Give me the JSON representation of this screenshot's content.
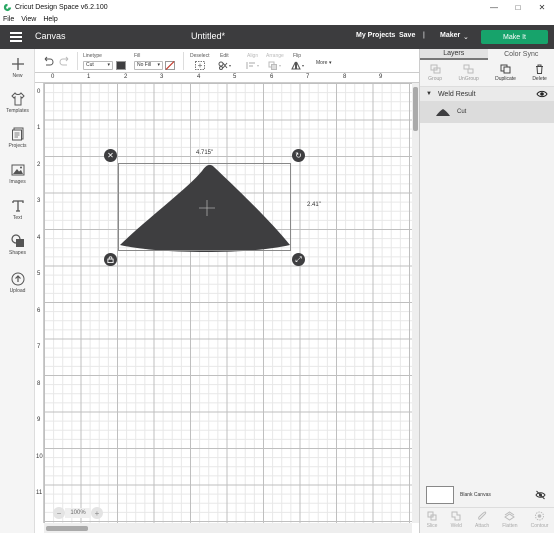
{
  "window": {
    "title": "Cricut Design Space  v6.2.100"
  },
  "menu": [
    "File",
    "View",
    "Help"
  ],
  "header": {
    "section": "Canvas",
    "document_title": "Untitled*",
    "my_projects": "My Projects",
    "save": "Save",
    "separator": "|",
    "machine": "Maker",
    "make_it": "Make It"
  },
  "left_tools": [
    {
      "label": "New",
      "icon": "plus-icon"
    },
    {
      "label": "Templates",
      "icon": "shirt-icon"
    },
    {
      "label": "Projects",
      "icon": "projects-icon"
    },
    {
      "label": "Images",
      "icon": "image-icon"
    },
    {
      "label": "Text",
      "icon": "text-icon"
    },
    {
      "label": "Shapes",
      "icon": "shapes-icon"
    },
    {
      "label": "Upload",
      "icon": "upload-icon"
    }
  ],
  "edit_bar": {
    "linetype_label": "Linetype",
    "linetype_value": "Cut",
    "fill_label": "Fill",
    "fill_value": "No Fill",
    "deselect": "Deselect",
    "edit": "Edit",
    "align": "Align",
    "arrange": "Arrange",
    "flip": "Flip",
    "more": "More"
  },
  "ruler": {
    "top": [
      "0",
      "1",
      "2",
      "3",
      "4",
      "5",
      "6",
      "7",
      "8",
      "9"
    ],
    "left": [
      "0",
      "1",
      "2",
      "3",
      "4",
      "5",
      "6",
      "7",
      "8",
      "9",
      "10",
      "11"
    ]
  },
  "selection": {
    "width": "4.715\"",
    "height": "2.41\""
  },
  "zoom": {
    "value": "100%",
    "minus": "−",
    "plus": "+"
  },
  "right_panel": {
    "tabs": [
      "Layers",
      "Color Sync"
    ],
    "layer_tools": [
      {
        "label": "Group",
        "enabled": false
      },
      {
        "label": "UnGroup",
        "enabled": false
      },
      {
        "label": "Duplicate",
        "enabled": true
      },
      {
        "label": "Delete",
        "enabled": true
      }
    ],
    "group_name": "Weld Result",
    "layer_name": "Cut",
    "blank_canvas": "Blank Canvas",
    "bottom_tools": [
      "Slice",
      "Weld",
      "Attach",
      "Flatten",
      "Contour"
    ]
  },
  "colors": {
    "header": "#3c3c3e",
    "make_it": "#17a36b",
    "shape": "#3e3e40"
  }
}
